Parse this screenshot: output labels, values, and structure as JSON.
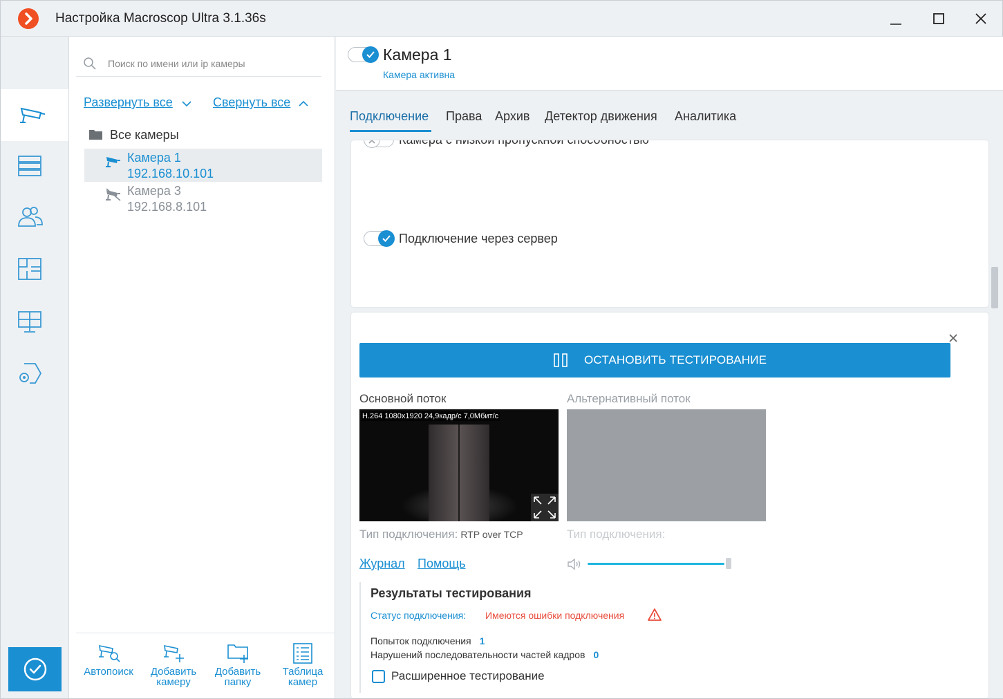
{
  "window": {
    "title": "Настройка Macroscop Ultra 3.1.36s"
  },
  "colors": {
    "accent": "#1a8fd2",
    "logo": "#f04e23",
    "error": "#e84d3d"
  },
  "leftnav": {
    "items": [
      {
        "icon": "camera-icon",
        "active": true
      },
      {
        "icon": "server-icon",
        "active": false
      },
      {
        "icon": "users-icon",
        "active": false
      },
      {
        "icon": "layout-icon",
        "active": false
      },
      {
        "icon": "monitor-icon",
        "active": false
      },
      {
        "icon": "camera-settings-icon",
        "active": false
      }
    ],
    "apply_icon": "check-circle-icon"
  },
  "list": {
    "search_placeholder": "Поиск по имени или ip камеры",
    "expand_all": "Развернуть все",
    "collapse_all": "Свернуть все",
    "root_label": "Все камеры",
    "cameras": [
      {
        "name": "Камера 1",
        "ip": "192.168.10.101",
        "active": true,
        "selected": true
      },
      {
        "name": "Камера 3",
        "ip": "192.168.8.101",
        "active": false,
        "selected": false
      }
    ],
    "tools": [
      {
        "label": "Автопоиск",
        "icon": "auto-search-icon"
      },
      {
        "label": "Добавить камеру",
        "icon": "add-camera-icon"
      },
      {
        "label": "Добавить папку",
        "icon": "add-folder-icon"
      },
      {
        "label": "Таблица камер",
        "icon": "camera-table-icon"
      }
    ]
  },
  "camera": {
    "title": "Камера 1",
    "status": "Камера активна",
    "enabled": true
  },
  "tabs": [
    "Подключение",
    "Права",
    "Архив",
    "Детектор движения",
    "Аналитика"
  ],
  "active_tab": "Подключение",
  "connection": {
    "low_bandwidth_label": "Камера с низкой пропускной способностью",
    "low_bandwidth_on": false,
    "via_server_label": "Подключение через сервер",
    "via_server_on": true
  },
  "testing": {
    "stop_label": "ОСТАНОВИТЬ ТЕСТИРОВАНИЕ",
    "main_stream_label": "Основной поток",
    "alt_stream_label": "Альтернативный поток",
    "main_stream_stats": "H.264 1080x1920 24,9кадр/с 7,0Мбит/с",
    "conn_type_label": "Тип подключения:",
    "main_conn_type": "RTP over TCP",
    "alt_conn_type_label": "Тип подключения:",
    "journal_link": "Журнал",
    "help_link": "Помощь",
    "volume_level": 1.0,
    "results": {
      "title": "Результаты тестирования",
      "status_label": "Статус подключения:",
      "status_value": "Имеются ошибки подключения",
      "attempts_label": "Попыток подключения",
      "attempts_value": "1",
      "violations_label": "Нарушений последовательности частей кадров",
      "violations_value": "0",
      "extended_label": "Расширенное тестирование",
      "extended_checked": false
    }
  }
}
